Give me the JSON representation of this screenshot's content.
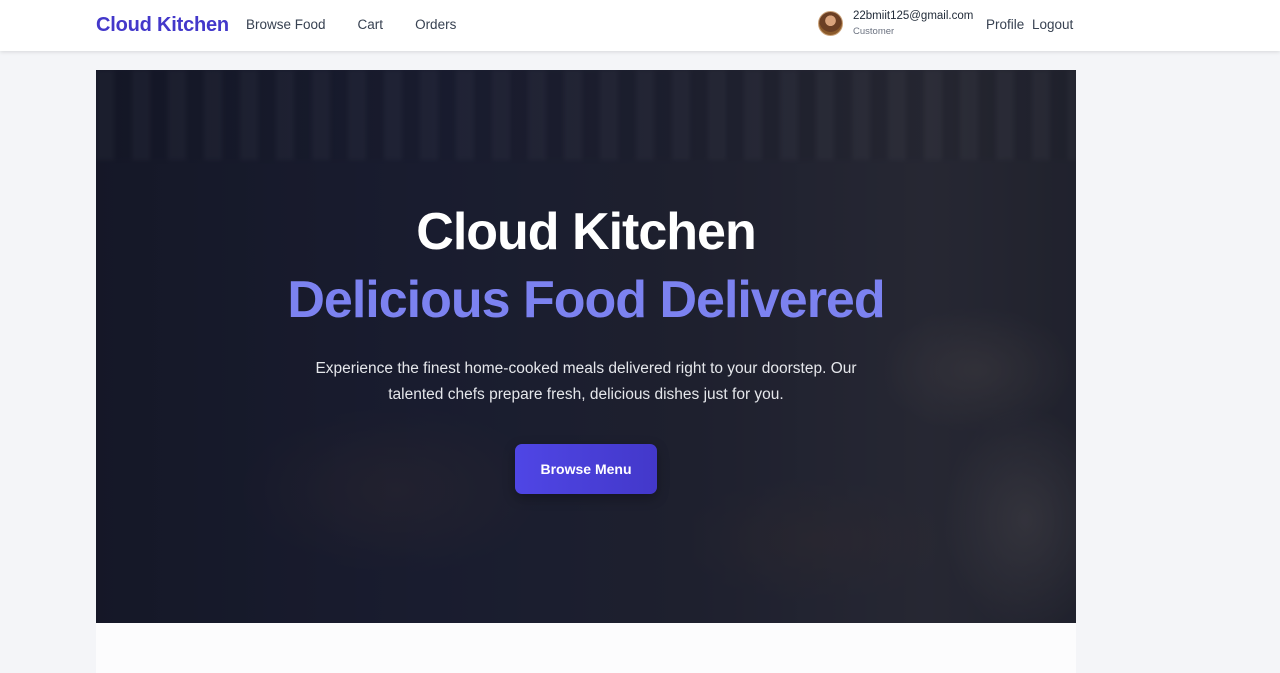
{
  "navbar": {
    "brand": "Cloud Kitchen",
    "links": [
      "Browse Food",
      "Cart",
      "Orders"
    ],
    "user": {
      "email": "22bmiit125@gmail.com",
      "role": "Customer"
    },
    "profile_label": "Profile",
    "logout_label": "Logout"
  },
  "hero": {
    "title": "Cloud Kitchen",
    "subtitle": "Delicious Food Delivered",
    "description": "Experience the finest home-cooked meals delivered right to your doorstep. Our talented chefs prepare fresh, delicious dishes just for you.",
    "cta_label": "Browse Menu"
  },
  "colors": {
    "brand": "#4338ca",
    "accent": "#7c82f0",
    "button": "#4f46e5"
  }
}
